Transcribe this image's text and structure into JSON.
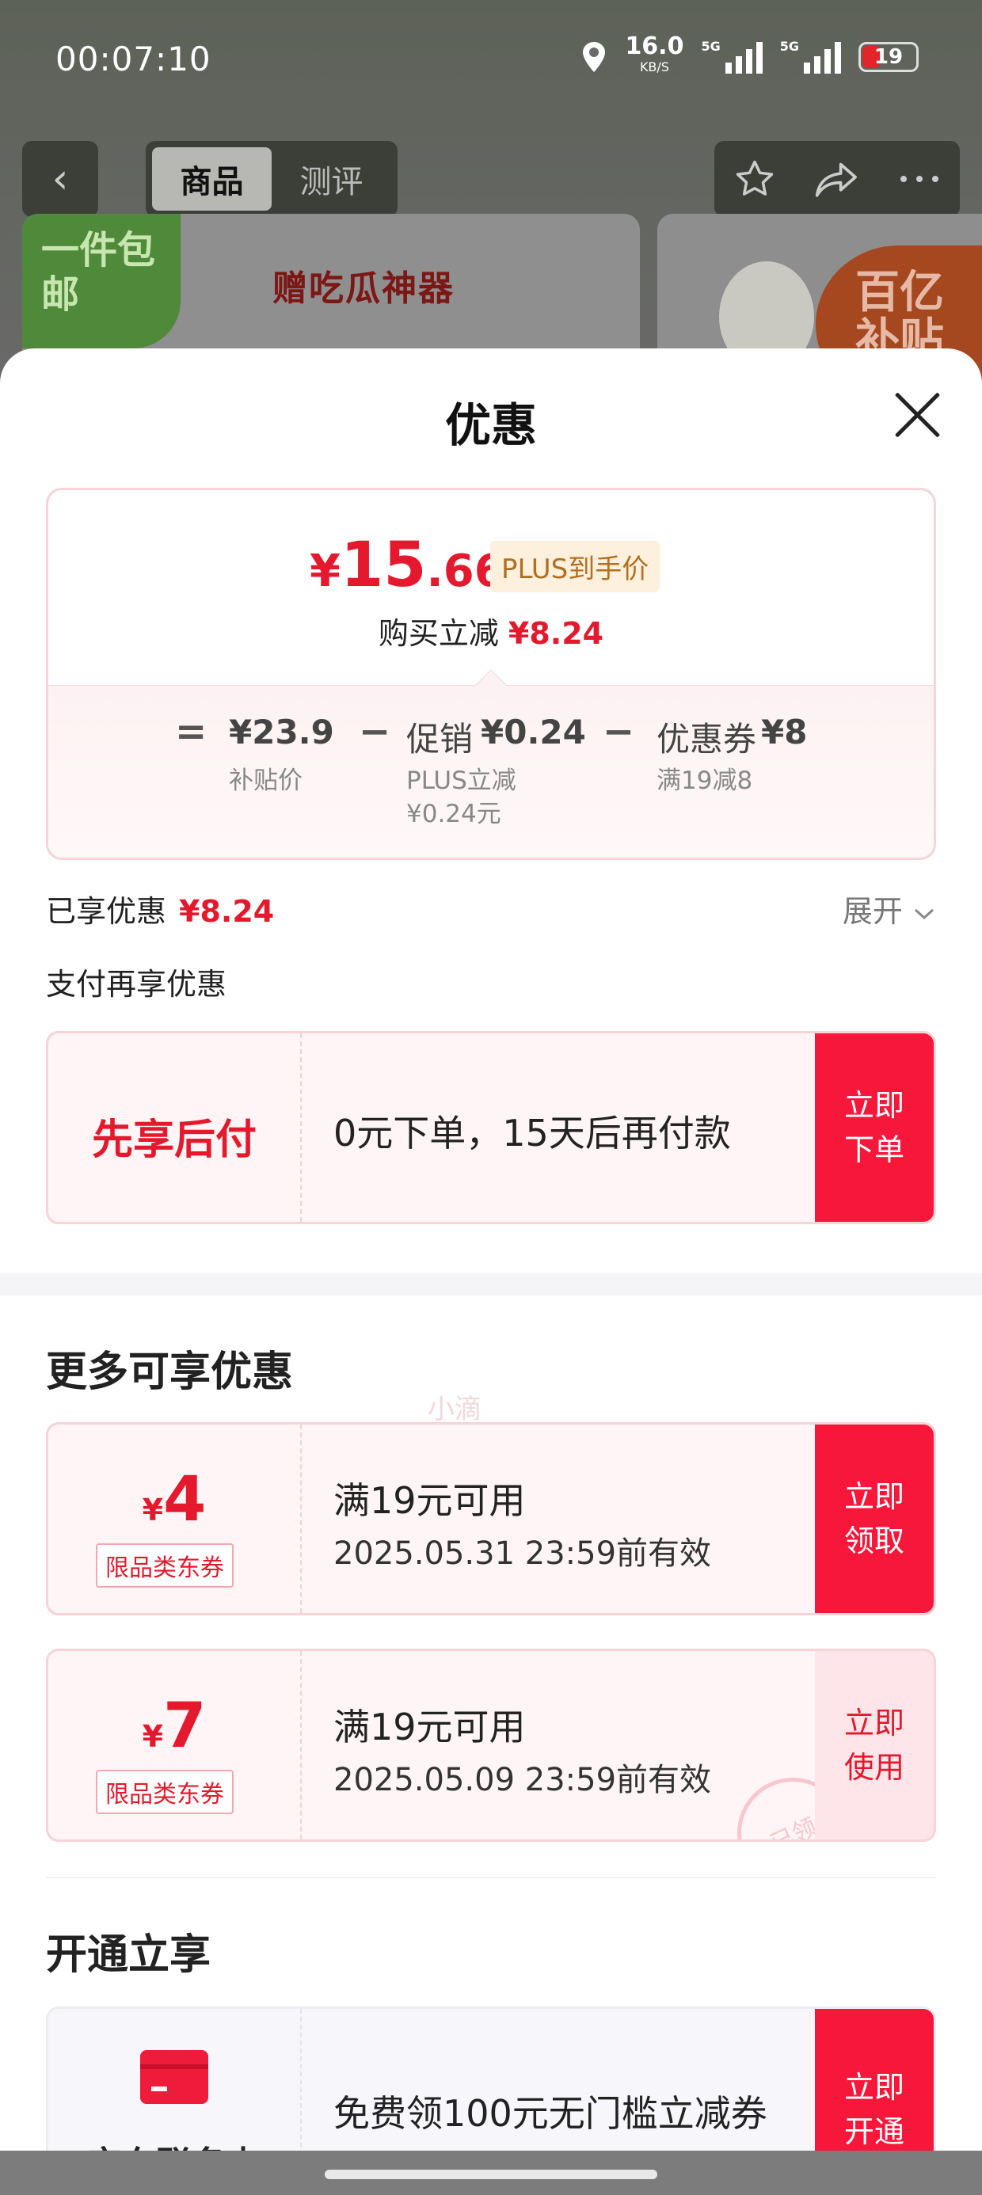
{
  "status_bar": {
    "time": "00:07:10",
    "net_speed": "16.0",
    "net_unit": "KB/S",
    "net_type_1": "5G",
    "net_type_2": "5G",
    "battery": "19"
  },
  "nav": {
    "back": "‹",
    "tabs": [
      {
        "label": "商品",
        "active": true
      },
      {
        "label": "测评",
        "active": false
      }
    ]
  },
  "banner": {
    "tag": "一件包邮",
    "text": "赠吃瓜神器",
    "badge": "百亿补贴"
  },
  "sheet": {
    "title": "优惠"
  },
  "price_card": {
    "currency": "¥",
    "final_int": "15",
    "final_dec": ".66",
    "plus_label": "PLUS到手价",
    "reduce_label": "购买立减",
    "reduce_value": "¥8.24",
    "equals": "=",
    "base_price": "¥23.9",
    "base_label": "补贴价",
    "minus": "−",
    "promo_label": "促销",
    "promo_value": "¥0.24",
    "promo_sub1": "PLUS立减",
    "promo_sub2": "¥0.24元",
    "coupon_label": "优惠券",
    "coupon_value": "¥8",
    "coupon_sub": "满19减8"
  },
  "enjoyed": {
    "label": "已享优惠",
    "value": "¥8.24",
    "expand": "展开"
  },
  "pay_section": {
    "title": "支付再享优惠"
  },
  "pay_later": {
    "title": "先享后付",
    "text": "0元下单，15天后再付款",
    "action_line1": "立即",
    "action_line2": "下单"
  },
  "watermark": "小滴",
  "more_section": {
    "title": "更多可享优惠"
  },
  "coupons": [
    {
      "currency": "¥",
      "amount": "4",
      "tag": "限品类东券",
      "condition": "满19元可用",
      "expiry": "2025.05.31 23:59前有效",
      "action_line1": "立即",
      "action_line2": "领取",
      "claimed": false
    },
    {
      "currency": "¥",
      "amount": "7",
      "tag": "限品类东券",
      "condition": "满19元可用",
      "expiry": "2025.05.09 23:59前有效",
      "action_line1": "立即",
      "action_line2": "使用",
      "claimed": true,
      "stamp": "已领"
    }
  ],
  "open_section": {
    "title": "开通立享"
  },
  "member_card": {
    "name": "京东联名卡",
    "text": "免费领100元无门槛立减券",
    "action_line1": "立即",
    "action_line2": "开通"
  },
  "colors": {
    "accent": "#e4192d",
    "action_bg": "#f7173a",
    "plus_tag_bg": "#fdf0dc"
  },
  "icons": {
    "back": "chevron-left-icon",
    "favorite": "star-icon",
    "share": "share-icon",
    "more": "more-icon",
    "close": "close-icon",
    "location": "location-icon",
    "expand": "chevron-down-icon"
  }
}
